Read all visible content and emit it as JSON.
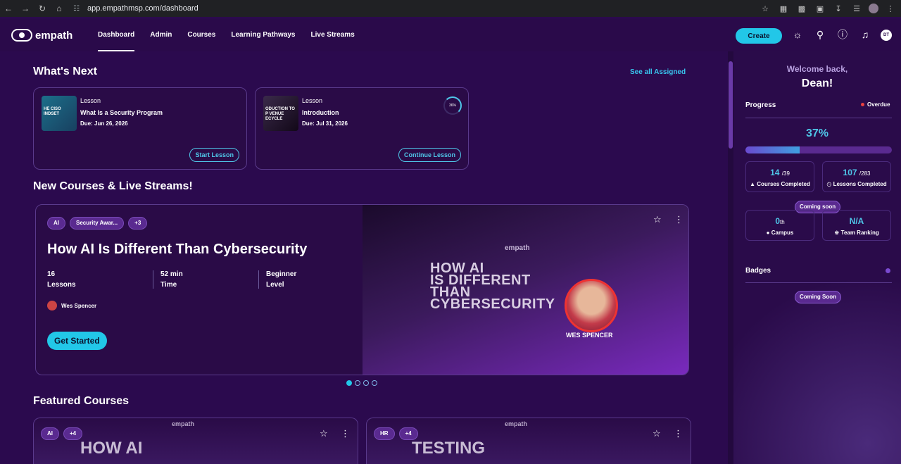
{
  "browser": {
    "url": "app.empathmsp.com/dashboard",
    "icons": [
      "back-icon",
      "forward-icon",
      "reload-icon",
      "home-icon",
      "site-info-icon",
      "bookmark-star-icon",
      "extension-icon",
      "download-icon",
      "profile-icon",
      "menu-icon"
    ]
  },
  "nav": {
    "brand": "empath",
    "links": [
      "Dashboard",
      "Admin",
      "Courses",
      "Learning Pathways",
      "Live Streams"
    ],
    "create": "Create",
    "avatar": "DT"
  },
  "whats_next": {
    "title": "What's Next",
    "see_all": "See all Assigned",
    "cards": [
      {
        "kind": "Lesson",
        "title": "What Is a Security Program",
        "due": "Due: Jun 26, 2026",
        "thumb": "HE CISO INDSET",
        "cta": "Start Lesson"
      },
      {
        "kind": "Lesson",
        "title": "Introduction",
        "due": "Due: Jul 31, 2026",
        "thumb": "ODUCTION TO P VENUE ECYCLE",
        "cta": "Continue Lesson",
        "progress": "36%"
      }
    ]
  },
  "new_courses": {
    "title": "New Courses & Live Streams!",
    "hero": {
      "tags": [
        "AI",
        "Security Awar...",
        "+3"
      ],
      "title": "How AI Is Different Than Cybersecurity",
      "stats": [
        {
          "value": "16",
          "label": "Lessons"
        },
        {
          "value": "52 min",
          "label": "Time"
        },
        {
          "value": "Beginner",
          "label": "Level"
        }
      ],
      "author": "Wes Spencer",
      "cta": "Get Started",
      "art_brand": "empath",
      "art_lines": [
        "HOW AI",
        "IS DIFFERENT",
        "THAN",
        "CYBERSECURITY"
      ],
      "art_name": "WES SPENCER"
    },
    "dots": 4,
    "active_dot": 0
  },
  "featured": {
    "title": "Featured Courses",
    "cards": [
      {
        "tags": [
          "AI",
          "+4"
        ],
        "brand": "empath",
        "art": "HOW AI"
      },
      {
        "tags": [
          "HR",
          "+4"
        ],
        "brand": "empath",
        "art": "TESTING"
      }
    ]
  },
  "panel": {
    "welcome": "Welcome back,",
    "name": "Dean!",
    "progress_label": "Progress",
    "overdue": "Overdue",
    "percent": "37%",
    "percent_value": 0.37,
    "courses": {
      "value": "14",
      "total": "/39",
      "label": "Courses Completed"
    },
    "lessons": {
      "value": "107",
      "total": "/283",
      "label": "Lessons Completed"
    },
    "coming_soon": "Coming soon",
    "campus": {
      "value": "0",
      "suffix": "th",
      "label": "Campus"
    },
    "team": {
      "value": "N/A",
      "label": "Team Ranking"
    },
    "badges_label": "Badges",
    "badges_soon": "Coming Soon"
  },
  "colors": {
    "accent": "#22c7e8",
    "bg": "#2b0a4e",
    "overdue": "#e84040"
  }
}
